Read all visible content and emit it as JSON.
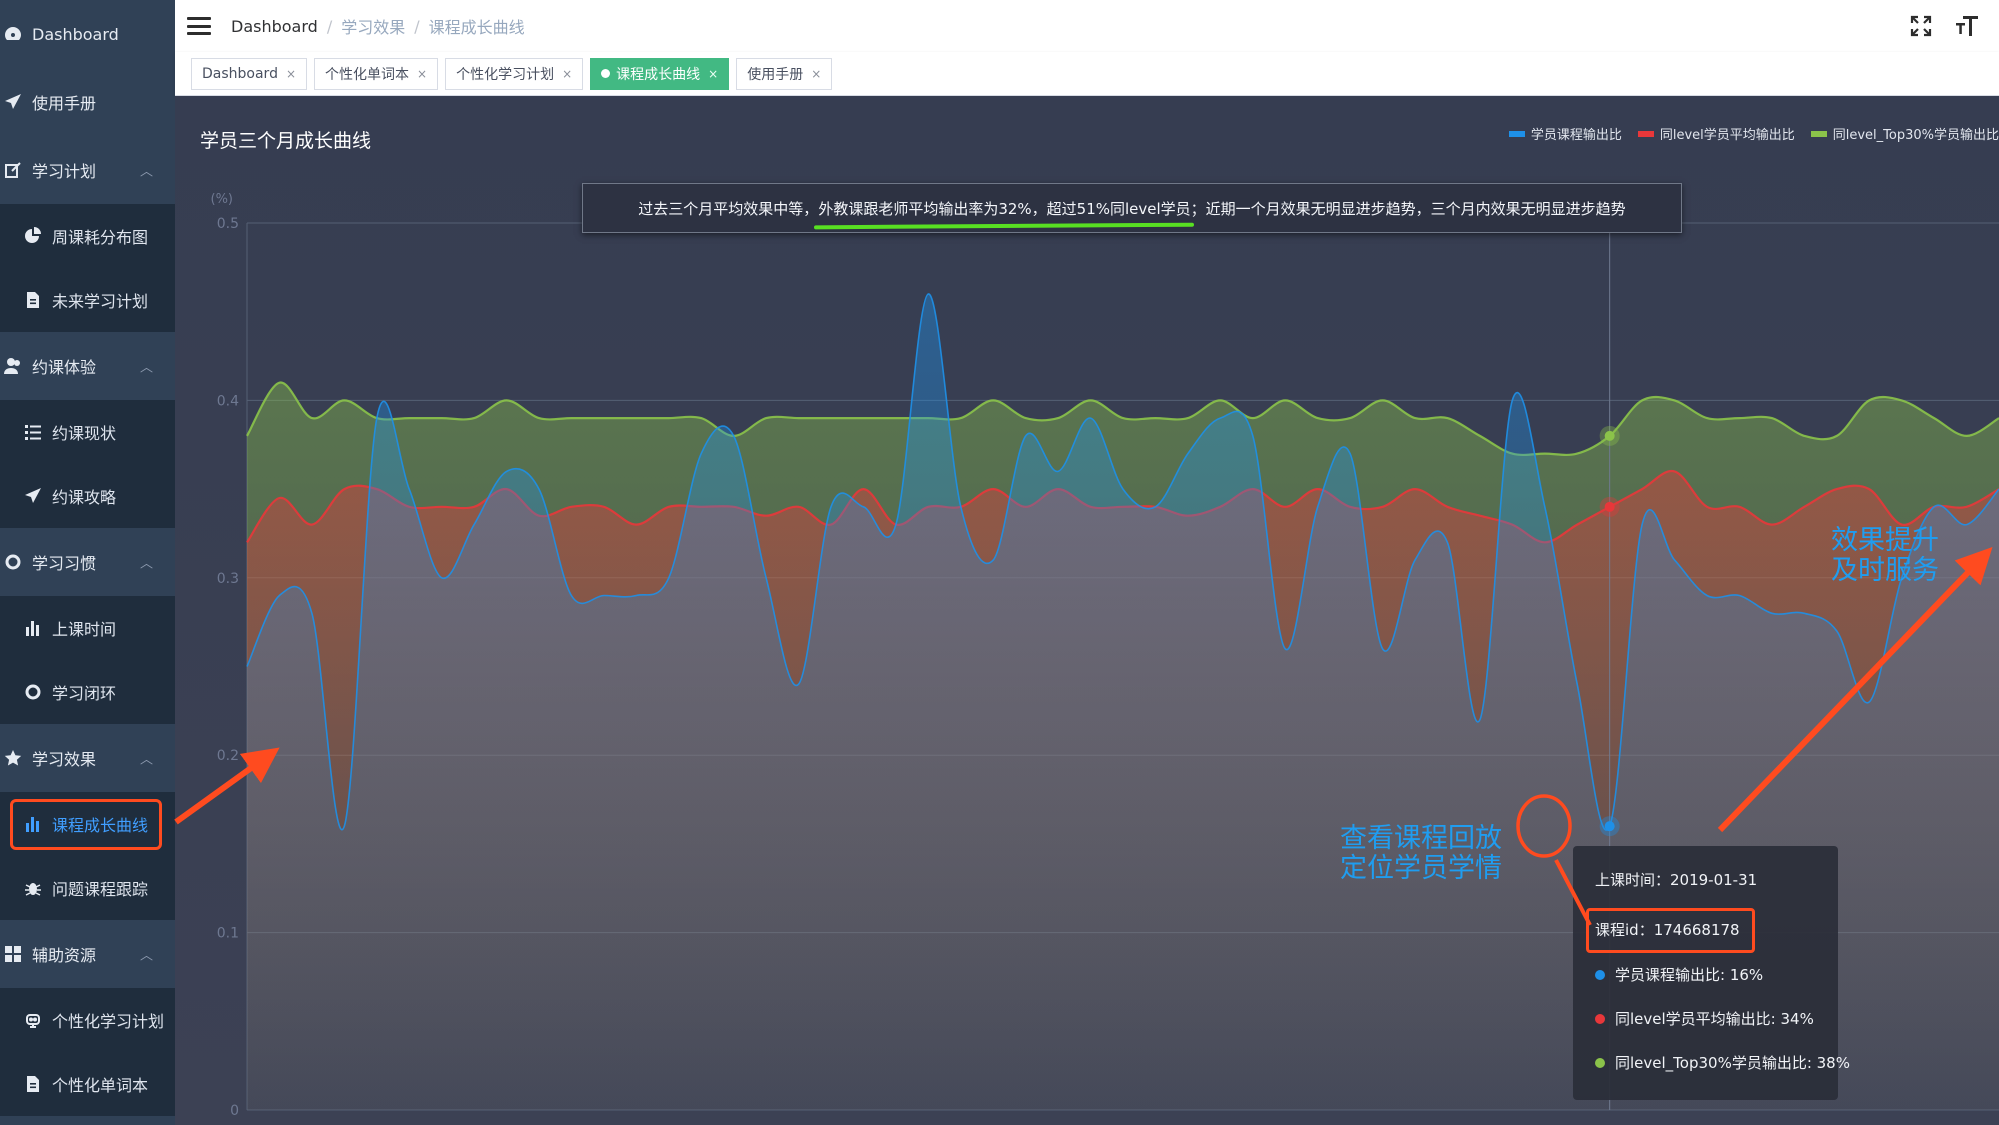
{
  "sidebar": {
    "items": [
      {
        "label": "Dashboard",
        "icon": "dashboard-icon",
        "level": "top"
      },
      {
        "label": "使用手册",
        "icon": "paper-plane-icon",
        "level": "top"
      },
      {
        "label": "学习计划",
        "icon": "edit-icon",
        "level": "top",
        "expanded": true
      },
      {
        "label": "周课耗分布图",
        "icon": "pie-chart-icon",
        "level": "sub"
      },
      {
        "label": "未来学习计划",
        "icon": "document-icon",
        "level": "sub"
      },
      {
        "label": "约课体验",
        "icon": "user-icon",
        "level": "top",
        "expanded": true
      },
      {
        "label": "约课现状",
        "icon": "list-icon",
        "level": "sub"
      },
      {
        "label": "约课攻略",
        "icon": "paper-plane-icon",
        "level": "sub"
      },
      {
        "label": "学习习惯",
        "icon": "cycle-icon",
        "level": "top",
        "expanded": true
      },
      {
        "label": "上课时间",
        "icon": "bar-chart-icon",
        "level": "sub"
      },
      {
        "label": "学习闭环",
        "icon": "cycle-icon",
        "level": "sub"
      },
      {
        "label": "学习效果",
        "icon": "star-icon",
        "level": "top",
        "expanded": true
      },
      {
        "label": "课程成长曲线",
        "icon": "bar-chart-icon",
        "level": "sub",
        "active": true
      },
      {
        "label": "问题课程跟踪",
        "icon": "bug-icon",
        "level": "sub"
      },
      {
        "label": "辅助资源",
        "icon": "grid-icon",
        "level": "top",
        "expanded": true
      },
      {
        "label": "个性化学习计划",
        "icon": "robot-icon",
        "level": "sub"
      },
      {
        "label": "个性化单词本",
        "icon": "document-icon",
        "level": "sub"
      }
    ]
  },
  "navbar": {
    "breadcrumb": [
      "Dashboard",
      "学习效果",
      "课程成长曲线"
    ]
  },
  "tags": [
    {
      "label": "Dashboard",
      "active": false
    },
    {
      "label": "个性化单词本",
      "active": false
    },
    {
      "label": "个性化学习计划",
      "active": false
    },
    {
      "label": "课程成长曲线",
      "active": true
    },
    {
      "label": "使用手册",
      "active": false
    }
  ],
  "main": {
    "summary": {
      "prefix": "过去三个月平均效果中等，",
      "highlight": "外教课跟老师平均输出率为32%，超过51%同level学员",
      "suffix": "；近期一个月效果无明显进步趋势，三个月内效果无明显进步趋势"
    },
    "tooltip": {
      "time_label": "上课时间：2019-01-31",
      "course_id_label": "课程id：174668178",
      "rows": [
        {
          "label": "学员课程输出比: 16%",
          "color": "#1e90e8"
        },
        {
          "label": "同level学员平均输出比: 34%",
          "color": "#e8373a"
        },
        {
          "label": "同level_Top30%学员输出比: 38%",
          "color": "#8bc34a"
        }
      ]
    },
    "annotations": {
      "replay": [
        "查看课程回放",
        "定位学员学情"
      ],
      "improve": [
        "效果提升",
        "及时服务"
      ]
    }
  },
  "chart_data": {
    "type": "area",
    "title": "学员三个月成长曲线",
    "ylabel": "(%)",
    "ylim": [
      0,
      0.5
    ],
    "yticks": [
      "0",
      "0.1",
      "0.2",
      "0.3",
      "0.4",
      "0.5"
    ],
    "grid": true,
    "legend_position": "top-right",
    "highlight_index": 42,
    "series": [
      {
        "name": "学员课程输出比",
        "color": "#1e90e8",
        "values": [
          0.25,
          0.29,
          0.28,
          0.16,
          0.39,
          0.35,
          0.3,
          0.33,
          0.36,
          0.35,
          0.29,
          0.29,
          0.29,
          0.3,
          0.37,
          0.38,
          0.3,
          0.24,
          0.34,
          0.34,
          0.33,
          0.46,
          0.34,
          0.31,
          0.38,
          0.36,
          0.39,
          0.35,
          0.34,
          0.37,
          0.39,
          0.38,
          0.26,
          0.34,
          0.37,
          0.26,
          0.31,
          0.32,
          0.22,
          0.4,
          0.34,
          0.24,
          0.16,
          0.33,
          0.31,
          0.29,
          0.29,
          0.28,
          0.28,
          0.27,
          0.23,
          0.3,
          0.34,
          0.33,
          0.35
        ]
      },
      {
        "name": "同level学员平均输出比",
        "color": "#e8373a",
        "values": [
          0.32,
          0.345,
          0.33,
          0.35,
          0.35,
          0.34,
          0.34,
          0.34,
          0.35,
          0.335,
          0.34,
          0.34,
          0.33,
          0.34,
          0.34,
          0.34,
          0.335,
          0.34,
          0.33,
          0.35,
          0.33,
          0.34,
          0.34,
          0.35,
          0.34,
          0.35,
          0.34,
          0.34,
          0.34,
          0.335,
          0.34,
          0.35,
          0.34,
          0.35,
          0.34,
          0.34,
          0.35,
          0.34,
          0.335,
          0.33,
          0.32,
          0.33,
          0.34,
          0.35,
          0.36,
          0.34,
          0.34,
          0.33,
          0.34,
          0.35,
          0.35,
          0.33,
          0.34,
          0.34,
          0.35
        ]
      },
      {
        "name": "同level_Top30%学员输出比",
        "color": "#8bc34a",
        "values": [
          0.38,
          0.41,
          0.39,
          0.4,
          0.39,
          0.39,
          0.39,
          0.39,
          0.4,
          0.39,
          0.39,
          0.39,
          0.39,
          0.39,
          0.39,
          0.38,
          0.39,
          0.39,
          0.39,
          0.39,
          0.39,
          0.39,
          0.39,
          0.4,
          0.39,
          0.39,
          0.4,
          0.39,
          0.39,
          0.39,
          0.4,
          0.39,
          0.4,
          0.39,
          0.39,
          0.4,
          0.39,
          0.39,
          0.38,
          0.37,
          0.37,
          0.37,
          0.38,
          0.4,
          0.4,
          0.39,
          0.39,
          0.39,
          0.38,
          0.38,
          0.4,
          0.4,
          0.39,
          0.38,
          0.39
        ]
      }
    ]
  }
}
